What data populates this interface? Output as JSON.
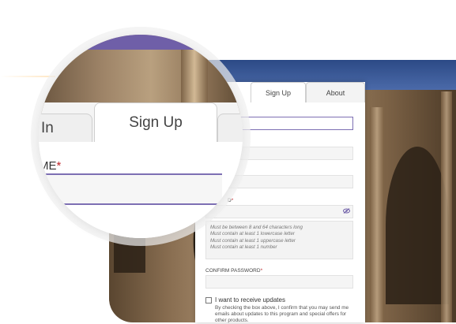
{
  "tabs": [
    {
      "label": "Sign Up",
      "active": true
    },
    {
      "label": "About",
      "active": false
    }
  ],
  "form": {
    "password_label": "D",
    "password_hints": [
      "Must be between 8 and 64 characters long",
      "Must contain at least 1 lowercase letter",
      "Must contain at least 1 uppercase letter",
      "Must contain at least 1 number"
    ],
    "confirm_password_label": "CONFIRM PASSWORD",
    "required_marker": "*",
    "updates_checkbox_label": "I want to receive updates",
    "updates_description": "By checking the box above, I confirm that you may send me emails about updates to this program and special offers for other products."
  },
  "magnifier": {
    "left_tab_label": "In",
    "active_tab_label": "Sign Up",
    "field_label": "ME",
    "required_marker": "*"
  },
  "colors": {
    "accent": "#6f5fa8",
    "focus_border": "#7d6fb3",
    "required": "#c0262b"
  },
  "icons": {
    "password_visibility": "eye-slash-icon"
  }
}
